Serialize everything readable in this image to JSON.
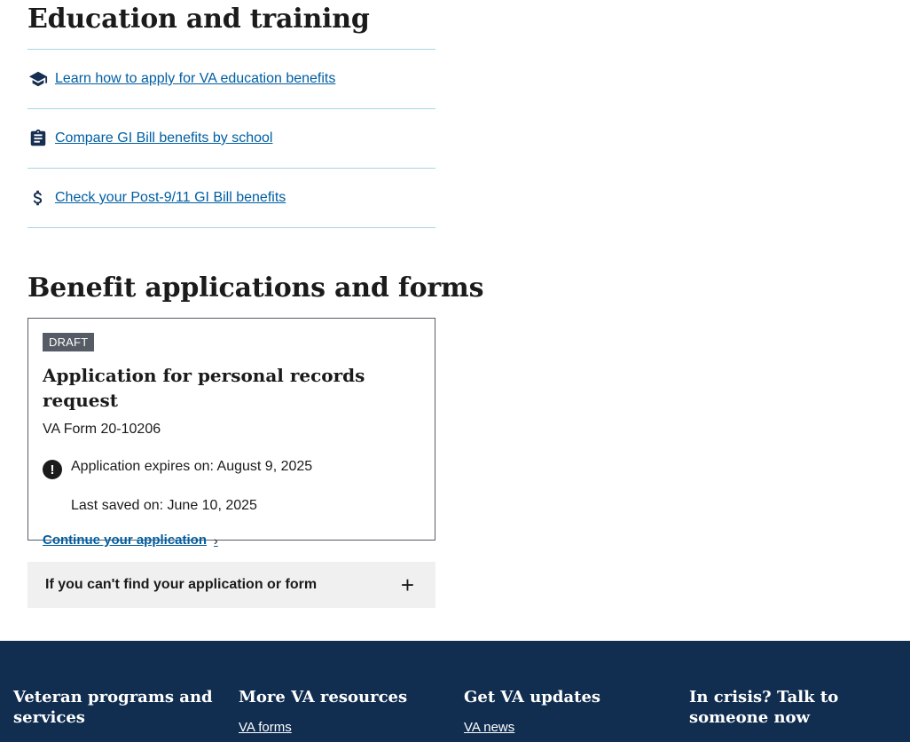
{
  "education": {
    "title": "Education and training",
    "links": [
      {
        "icon": "graduation-cap-icon",
        "label": "Learn how to apply for VA education benefits"
      },
      {
        "icon": "clipboard-icon",
        "label": "Compare GI Bill benefits by school"
      },
      {
        "icon": "dollar-sign-icon",
        "label": "Check your Post-9/11 GI Bill benefits"
      }
    ]
  },
  "forms": {
    "title": "Benefit applications and forms",
    "card": {
      "badge": "DRAFT",
      "title": "Application for personal records request",
      "form_number": "VA Form 20-10206",
      "expires": "Application expires on: August 9, 2025",
      "last_saved": "Last saved on: June 10, 2025",
      "continue_label": "Continue your application"
    },
    "accordion_label": "If you can't find your application or form"
  },
  "footer": {
    "background": "#112e51",
    "columns": [
      {
        "heading": "Veteran programs and services",
        "first_link": ""
      },
      {
        "heading": "More VA resources",
        "first_link": "VA forms"
      },
      {
        "heading": "Get VA updates",
        "first_link": "VA news"
      },
      {
        "heading": "In crisis? Talk to someone now",
        "first_link": ""
      }
    ]
  },
  "colors": {
    "link": "#005ea2",
    "divider": "#a9d4e4",
    "badge_bg": "#565c65",
    "accordion_bg": "#f0f0f0"
  }
}
